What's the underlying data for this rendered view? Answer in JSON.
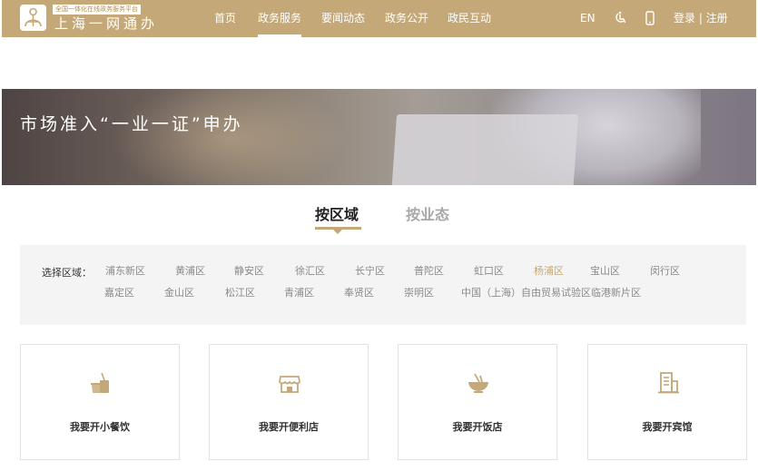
{
  "header": {
    "logo_tag": "全国一体化在线政务服务平台",
    "logo_name": "上海一网通办",
    "nav": [
      {
        "label": "首页"
      },
      {
        "label": "政务服务"
      },
      {
        "label": "要闻动态"
      },
      {
        "label": "政务公开"
      },
      {
        "label": "政民互动"
      }
    ],
    "lang": "EN",
    "auth": "登录 | 注册",
    "accent_color": "#c4a877"
  },
  "banner": {
    "title": "市场准入“一业一证”申办"
  },
  "tabs": [
    {
      "label": "按区域"
    },
    {
      "label": "按业态"
    }
  ],
  "region": {
    "label": "选择区域：",
    "selected": "杨浦区",
    "row1": [
      "浦东新区",
      "黄浦区",
      "静安区",
      "徐汇区",
      "长宁区",
      "普陀区",
      "虹口区",
      "杨浦区",
      "宝山区",
      "闵行区"
    ],
    "row2": [
      "嘉定区",
      "金山区",
      "松江区",
      "青浦区",
      "奉贤区",
      "崇明区",
      "中国（上海）自由贸易试验区临港新片区"
    ]
  },
  "cards": [
    {
      "label": "我要开小餐饮",
      "icon": "snack-food-icon"
    },
    {
      "label": "我要开便利店",
      "icon": "convenience-store-icon"
    },
    {
      "label": "我要开饭店",
      "icon": "restaurant-bowl-icon"
    },
    {
      "label": "我要开宾馆",
      "icon": "hotel-building-icon"
    }
  ]
}
